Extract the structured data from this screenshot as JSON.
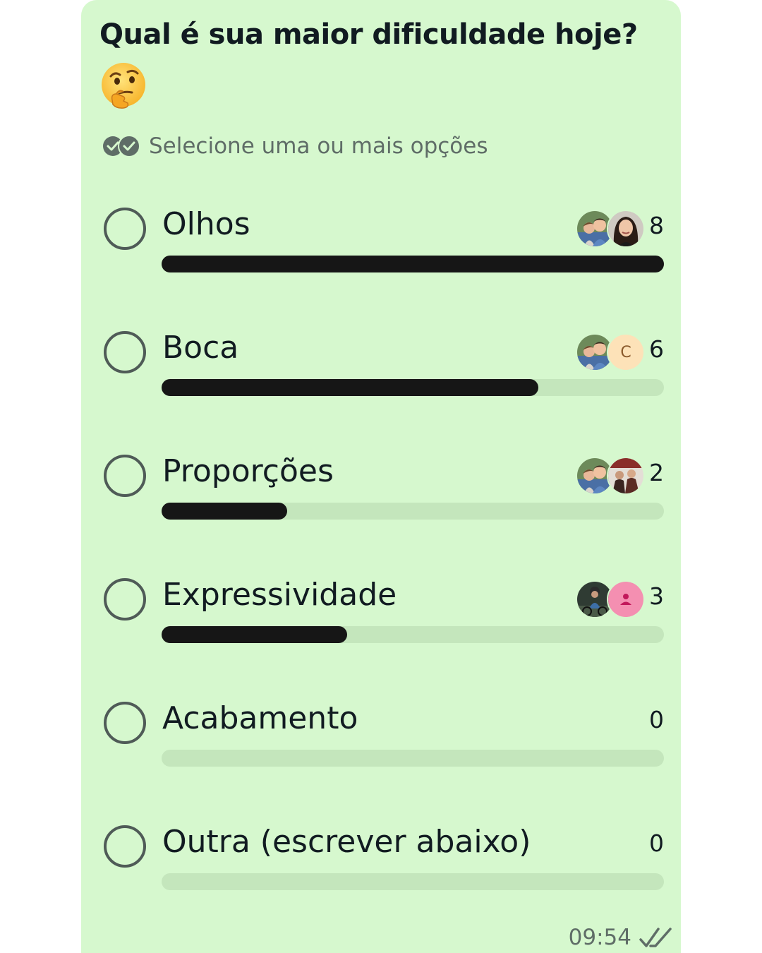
{
  "poll": {
    "title": "Qual é sua maior dificuldade hoje?",
    "title_emoji": "thinking-face-emoji",
    "subtitle": "Selecione uma ou mais opções",
    "subtitle_icon": "multi-select-check-icon",
    "max_votes": 8,
    "options": [
      {
        "label": "Olhos",
        "count": "8",
        "fraction": 1.0,
        "avatars": [
          "couple-photo-avatar",
          "woman-photo-avatar"
        ]
      },
      {
        "label": "Boca",
        "count": "6",
        "fraction": 0.75,
        "avatars": [
          "couple-photo-avatar",
          "letter-avatar"
        ],
        "avatar_letter": "C"
      },
      {
        "label": "Proporções",
        "count": "2",
        "fraction": 0.25,
        "avatars": [
          "couple-photo-avatar",
          "group-photo-avatar"
        ]
      },
      {
        "label": "Expressividade",
        "count": "3",
        "fraction": 0.37,
        "avatars": [
          "cyclist-photo-avatar",
          "default-person-avatar"
        ]
      },
      {
        "label": "Acabamento",
        "count": "0",
        "fraction": 0.0,
        "avatars": []
      },
      {
        "label": "Outra (escrever abaixo)",
        "count": "0",
        "fraction": 0.0,
        "avatars": []
      }
    ],
    "timestamp": "09:54",
    "status_icon": "double-check-icon"
  },
  "colors": {
    "bubble": "#d6f8ce",
    "bar_fill": "#161616",
    "bar_track": "#c4e6bc",
    "muted_text": "#5f6d67",
    "letter_avatar_bg": "#fde2b8",
    "person_avatar_bg": "#f48fb1"
  }
}
